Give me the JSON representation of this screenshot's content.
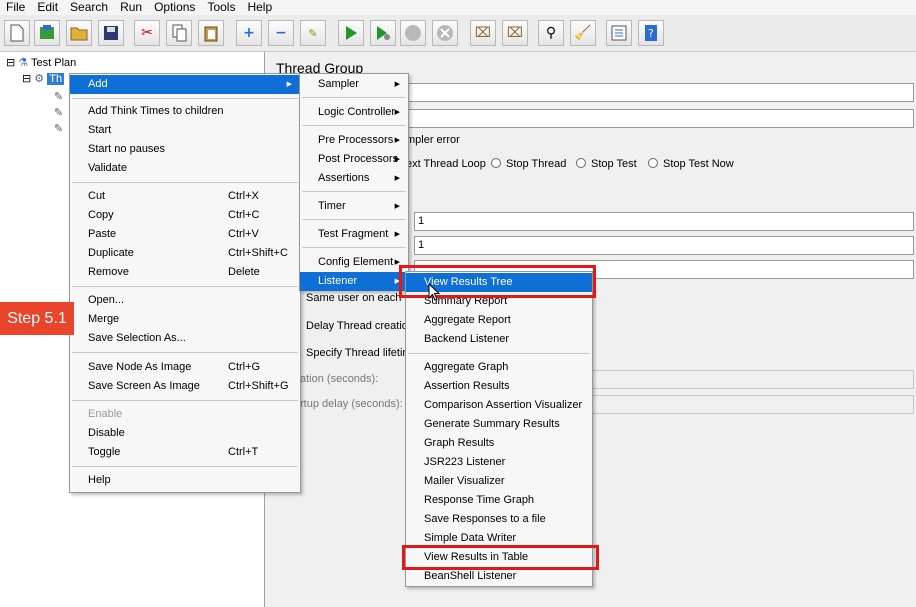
{
  "menubar": [
    "File",
    "Edit",
    "Search",
    "Run",
    "Options",
    "Tools",
    "Help"
  ],
  "toolbar_icons": [
    "new-icon",
    "templates-icon",
    "open-icon",
    "save-icon",
    "cut-icon",
    "copy-icon",
    "paste-icon",
    "expand-icon",
    "collapse-icon",
    "toggle-icon",
    "start-icon",
    "start-no-pauses-icon",
    "stop-icon",
    "shutdown-icon",
    "clear-icon",
    "clear-all-icon",
    "search-icon",
    "reset-search-icon",
    "function-helper-icon",
    "help-icon"
  ],
  "tree": {
    "root_label": "Test Plan",
    "selected_label": "Th"
  },
  "right_panel": {
    "title": "Thread Group",
    "error_label": "mpler error",
    "radio_options": [
      "ext Thread Loop",
      "Stop Thread",
      "Stop Test",
      "Stop Test Now"
    ],
    "field_values": [
      "1",
      "1"
    ],
    "checkbox_labels": [
      "Same user on each ite",
      "Delay Thread creation",
      "Specify Thread lifetime"
    ],
    "duration_label": "ation (seconds):",
    "startup_label": "rtup delay (seconds):"
  },
  "context_menu": {
    "add": "Add",
    "items1": [
      "Add Think Times to children",
      "Start",
      "Start no pauses",
      "Validate"
    ],
    "cut": {
      "label": "Cut",
      "shortcut": "Ctrl+X"
    },
    "copy": {
      "label": "Copy",
      "shortcut": "Ctrl+C"
    },
    "paste": {
      "label": "Paste",
      "shortcut": "Ctrl+V"
    },
    "duplicate": {
      "label": "Duplicate",
      "shortcut": "Ctrl+Shift+C"
    },
    "remove": {
      "label": "Remove",
      "shortcut": "Delete"
    },
    "open": "Open...",
    "merge": "Merge",
    "save_selection": "Save Selection As...",
    "save_node_image": {
      "label": "Save Node As Image",
      "shortcut": "Ctrl+G"
    },
    "save_screen_image": {
      "label": "Save Screen As Image",
      "shortcut": "Ctrl+Shift+G"
    },
    "enable": "Enable",
    "disable": "Disable",
    "toggle": {
      "label": "Toggle",
      "shortcut": "Ctrl+T"
    },
    "help": "Help"
  },
  "add_submenu": [
    "Sampler",
    "Logic Controller",
    "Pre Processors",
    "Post Processors",
    "Assertions",
    "Timer",
    "Test Fragment",
    "Config Element",
    "Listener"
  ],
  "listener_submenu": {
    "group1": [
      "View Results Tree",
      "Summary Report",
      "Aggregate Report",
      "Backend Listener"
    ],
    "group2": [
      "Aggregate Graph",
      "Assertion Results",
      "Comparison Assertion Visualizer",
      "Generate Summary Results",
      "Graph Results",
      "JSR223 Listener",
      "Mailer Visualizer",
      "Response Time Graph",
      "Save Responses to a file",
      "Simple Data Writer",
      "View Results in Table",
      "BeanShell Listener"
    ]
  },
  "step_badge": "Step 5.1",
  "colors": {
    "highlight": "#0e6fd6",
    "annotation_red": "#e01919",
    "badge": "#e8452a"
  }
}
